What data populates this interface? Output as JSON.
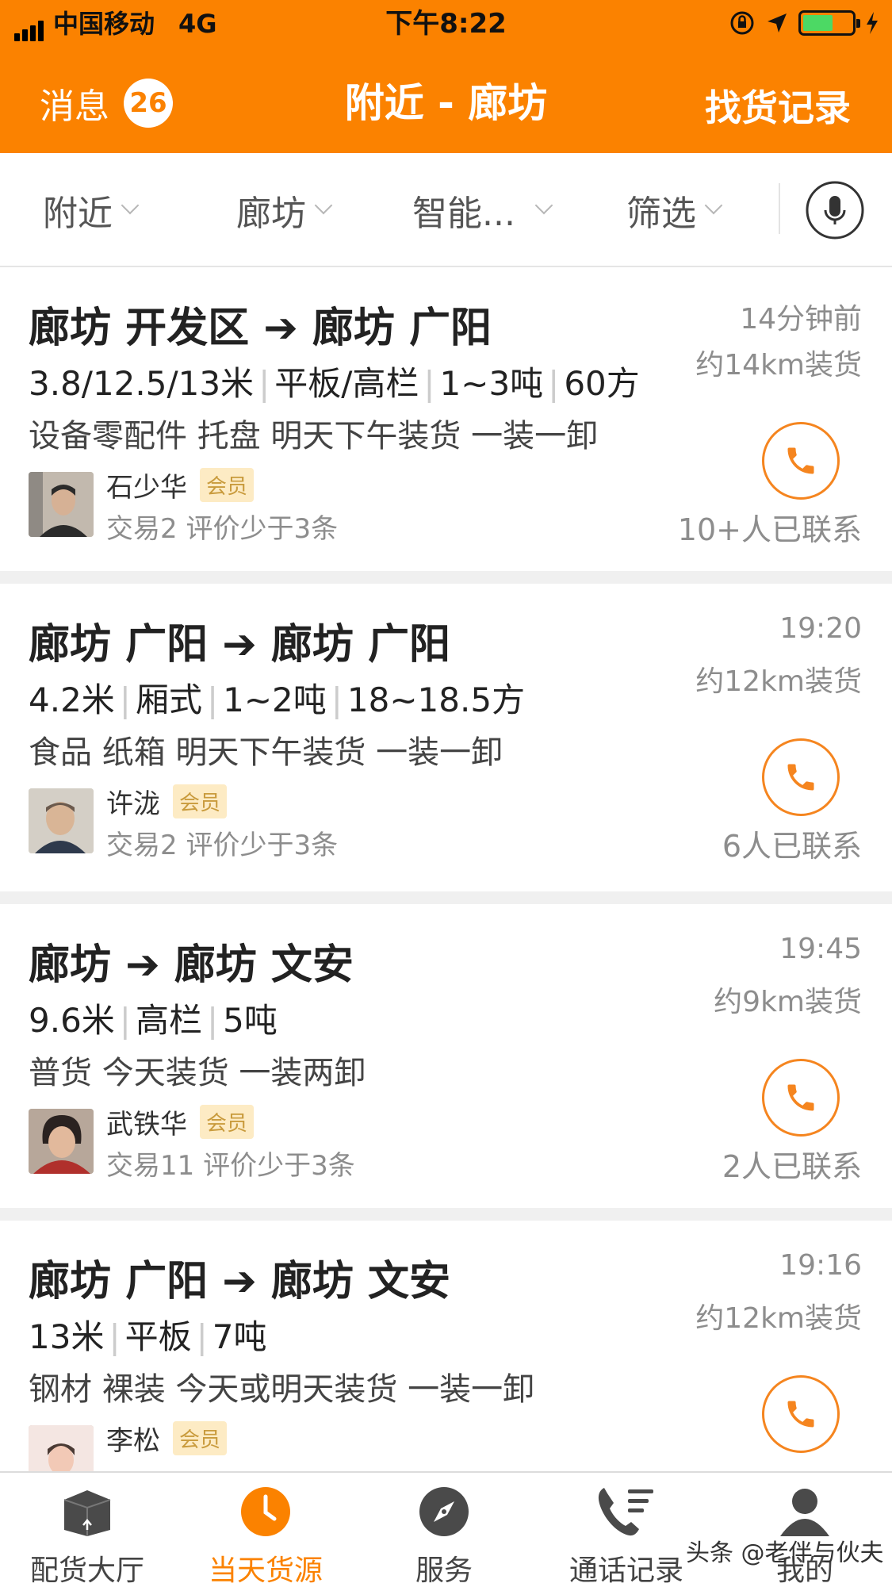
{
  "status_bar": {
    "carrier": "中国移动",
    "network": "4G",
    "time": "下午8:22"
  },
  "nav": {
    "left_label": "消息",
    "badge_count": "26",
    "title": "附近 - 廊坊",
    "right_label": "找货记录"
  },
  "filters": [
    {
      "label": "附近"
    },
    {
      "label": "廊坊"
    },
    {
      "label": "智能..."
    },
    {
      "label": "筛选"
    }
  ],
  "listings": [
    {
      "route": "廊坊 开发区 ➔ 廊坊 广阳",
      "specs": [
        "3.8/12.5/13米",
        "平板/高栏",
        "1~3吨",
        "60方"
      ],
      "desc": "设备零配件  托盘  明天下午装货  一装一卸",
      "user_name": "石少华",
      "member_label": "会员",
      "trade_info": "交易2  评价少于3条",
      "time": "14分钟前",
      "distance": "约14km装货",
      "contacted": "10+人已联系"
    },
    {
      "route": "廊坊 广阳 ➔ 廊坊 广阳",
      "specs": [
        "4.2米",
        "厢式",
        "1~2吨",
        "18~18.5方"
      ],
      "desc": "食品  纸箱  明天下午装货  一装一卸",
      "user_name": "许泷",
      "member_label": "会员",
      "trade_info": "交易2  评价少于3条",
      "time": "19:20",
      "distance": "约12km装货",
      "contacted": "6人已联系"
    },
    {
      "route": "廊坊 ➔ 廊坊 文安",
      "specs": [
        "9.6米",
        "高栏",
        "5吨"
      ],
      "desc": "普货  今天装货  一装两卸",
      "user_name": "武铁华",
      "member_label": "会员",
      "trade_info": "交易11  评价少于3条",
      "time": "19:45",
      "distance": "约9km装货",
      "contacted": "2人已联系"
    },
    {
      "route": "廊坊 广阳 ➔ 廊坊 文安",
      "specs": [
        "13米",
        "平板",
        "7吨"
      ],
      "desc": "钢材  裸装  今天或明天装货  一装一卸",
      "user_name": "李松",
      "member_label": "会员",
      "trade_info": "",
      "time": "19:16",
      "distance": "约12km装货",
      "contacted": ""
    }
  ],
  "tabs": [
    {
      "label": "配货大厅",
      "icon": "box-icon"
    },
    {
      "label": "当天货源",
      "icon": "clock-icon"
    },
    {
      "label": "服务",
      "icon": "compass-icon"
    },
    {
      "label": "通话记录",
      "icon": "phone-list-icon"
    },
    {
      "label": "我的",
      "icon": "person-icon"
    }
  ],
  "watermark": "头条 @老伴与伙夫",
  "colors": {
    "brand": "#fb8200",
    "call_ring": "#f5851f",
    "member_bg": "#fdebc4"
  }
}
